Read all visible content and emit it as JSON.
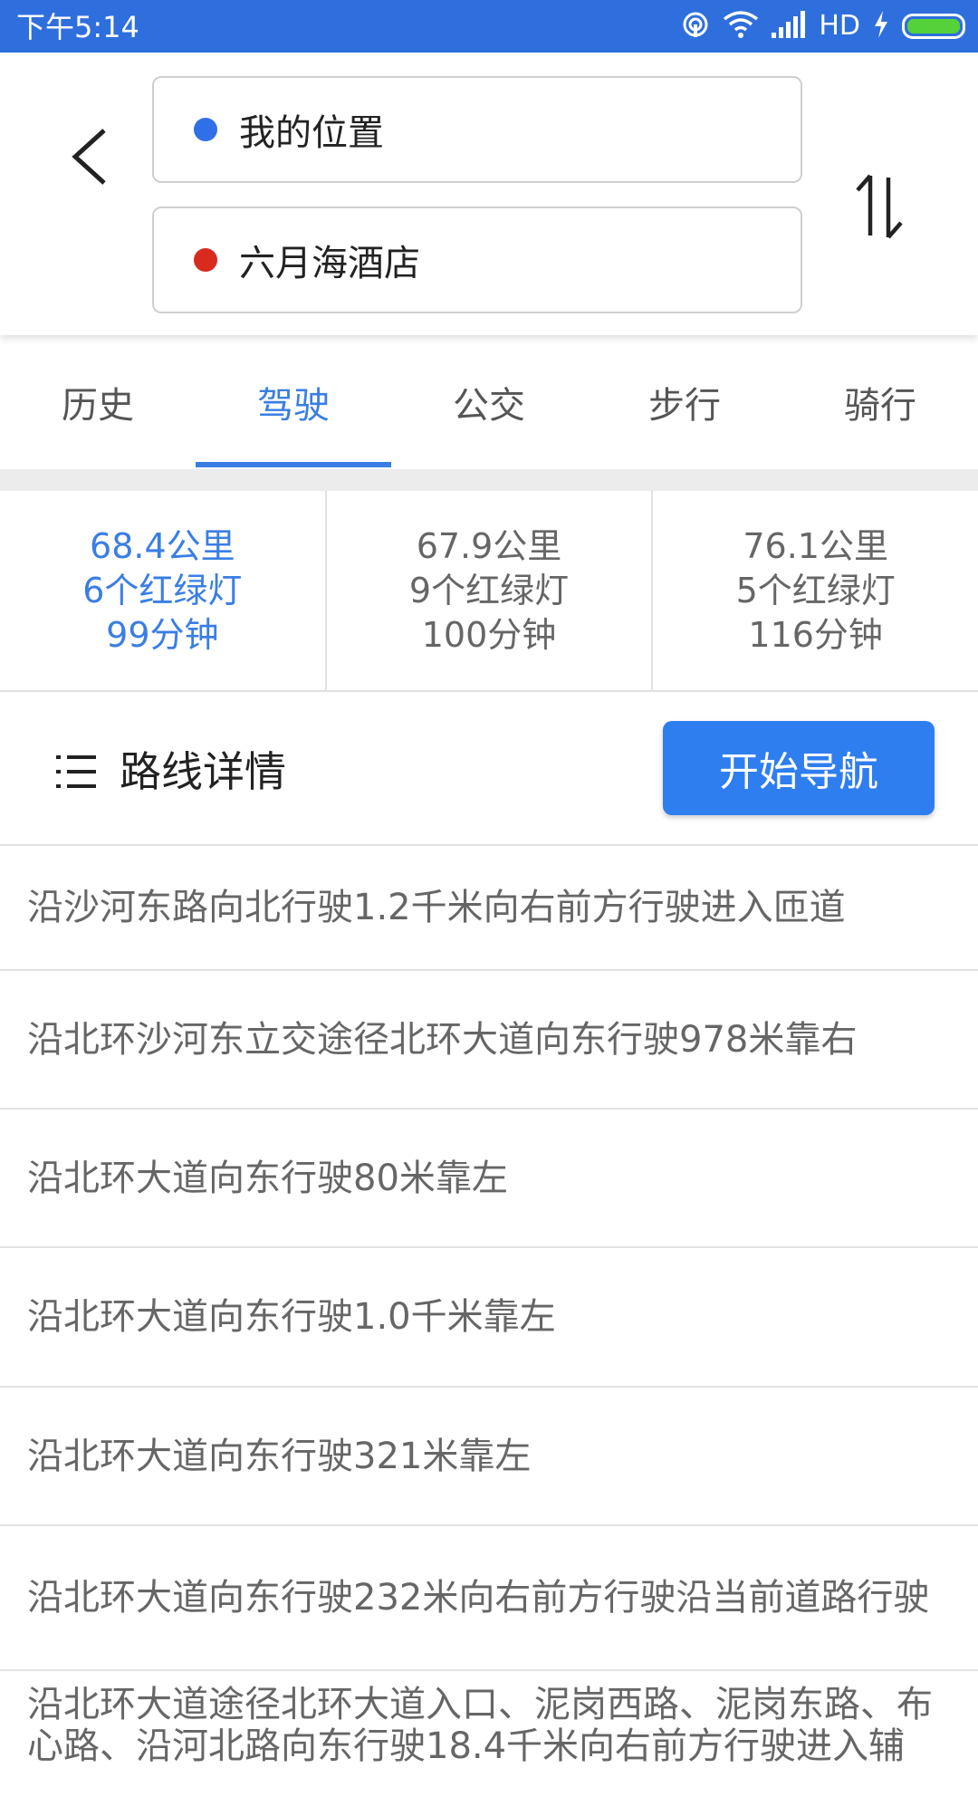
{
  "status_bar": {
    "time": "下午5:14",
    "network_label": "HD",
    "icons": [
      "hotspot-icon",
      "wifi-icon",
      "signal-icon",
      "charging-icon",
      "battery-icon"
    ],
    "background_color": "#2f6fdd",
    "battery_color": "#55d23a"
  },
  "header": {
    "back_icon": "chevron-left-icon",
    "origin": "我的位置",
    "origin_color": "#2f6fe8",
    "destination": "六月海酒店",
    "destination_color": "#d92a1e",
    "swap_icon": "swap-vertical-icon"
  },
  "tabs": [
    {
      "label": "历史",
      "active": false
    },
    {
      "label": "驾驶",
      "active": true
    },
    {
      "label": "公交",
      "active": false
    },
    {
      "label": "步行",
      "active": false
    },
    {
      "label": "骑行",
      "active": false
    }
  ],
  "routes": [
    {
      "distance": "68.4公里",
      "lights": "6个红绿灯",
      "time": "99分钟",
      "selected": true
    },
    {
      "distance": "67.9公里",
      "lights": "9个红绿灯",
      "time": "100分钟",
      "selected": false
    },
    {
      "distance": "76.1公里",
      "lights": "5个红绿灯",
      "time": "116分钟",
      "selected": false
    }
  ],
  "details": {
    "icon": "list-icon",
    "title": "路线详情",
    "start_nav_label": "开始导航",
    "accent_color": "#2f7ef0"
  },
  "steps": [
    "沿沙河东路向北行驶1.2千米向右前方行驶进入匝道",
    "沿北环沙河东立交途径北环大道向东行驶978米靠右",
    "沿北环大道向东行驶80米靠左",
    "沿北环大道向东行驶1.0千米靠左",
    "沿北环大道向东行驶321米靠左",
    "沿北环大道向东行驶232米向右前方行驶沿当前道路行驶",
    "沿北环大道途径北环大道入口、泥岗西路、泥岗东路、布心路、沿河北路向东行驶18.4千米向右前方行驶进入辅"
  ]
}
